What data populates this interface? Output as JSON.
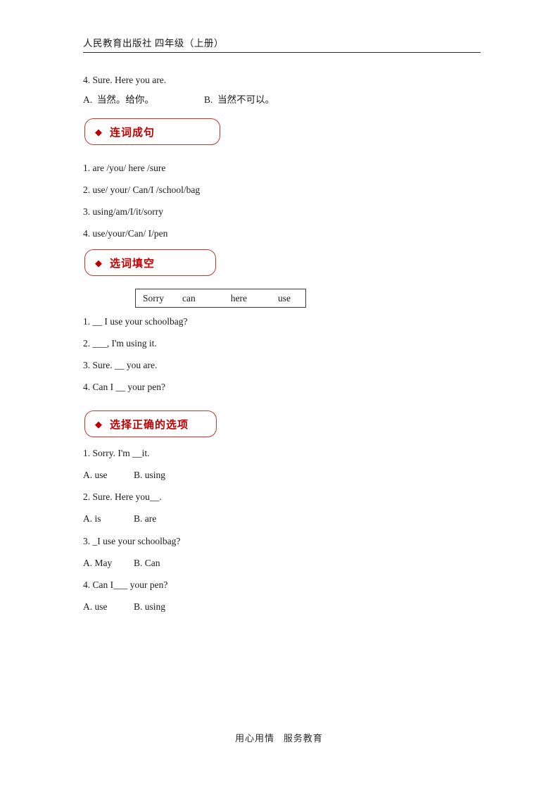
{
  "header": {
    "title": "人民教育出版社  四年级（上册）"
  },
  "intro": {
    "question": "4. Sure. Here you are.",
    "option_a": "A.  当然。给你。",
    "option_b": "B.  当然不可以。"
  },
  "sections": [
    {
      "bullet": "◆",
      "title": "连词成句",
      "icon": "diamond-icon",
      "items": [
        "1. are /you/ here /sure",
        "2. use/ your/ Can/I /school/bag",
        "3. using/am/I/it/sorry",
        "4. use/your/Can/ I/pen"
      ]
    },
    {
      "bullet": "◆",
      "title": "选词填空",
      "icon": "diamond-icon",
      "word_bank": [
        "Sorry",
        "can",
        "here",
        "use"
      ],
      "items": [
        "1. __ I use your schoolbag?",
        "2. ___, I'm using it.",
        "3. Sure. __ you are.",
        "4. Can I __ your pen?"
      ]
    },
    {
      "bullet": "◆",
      "title": "选择正确的选项",
      "icon": "diamond-icon",
      "questions": [
        {
          "prompt": "1. Sorry. I'm __it.",
          "option_a": "A. use",
          "option_b": "B. using"
        },
        {
          "prompt": "2. Sure. Here you__.",
          "option_a": "A. is",
          "option_b": "B. are"
        },
        {
          "prompt": "3. _I use your schoolbag?",
          "option_a": "A. May",
          "option_b": "B. Can"
        },
        {
          "prompt": "4. Can I___ your pen?",
          "option_a": "A. use",
          "option_b": "B. using"
        }
      ]
    }
  ],
  "footer": {
    "text": "用心用情   服务教育"
  },
  "colors": {
    "accent_red": "#c00000",
    "border_red": "#c0392b",
    "text": "#1a1a1a"
  }
}
